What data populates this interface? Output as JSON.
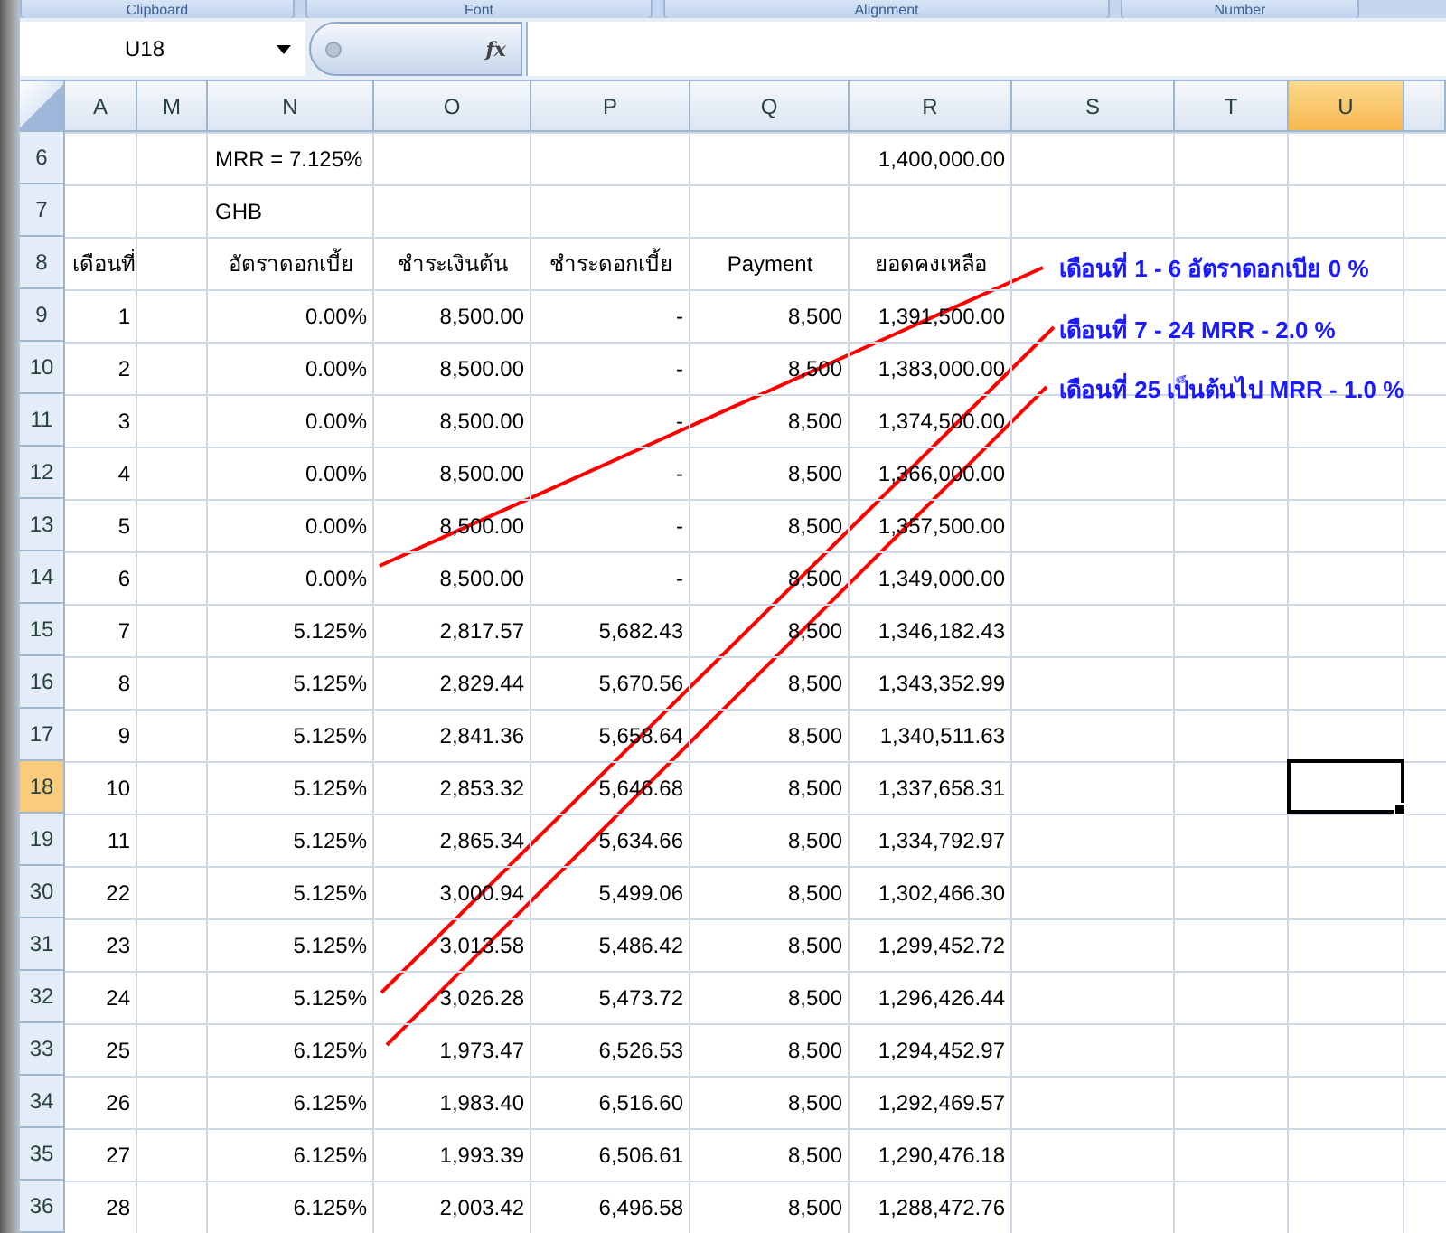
{
  "ribbon_groups": [
    {
      "label": "Clipboard"
    },
    {
      "label": "Font"
    },
    {
      "label": "Alignment"
    },
    {
      "label": "Number"
    }
  ],
  "formula_bar": {
    "name_box": "U18",
    "fx": "fx"
  },
  "columns": [
    {
      "label": "A",
      "selected": false
    },
    {
      "label": "M",
      "selected": false
    },
    {
      "label": "N",
      "selected": false
    },
    {
      "label": "O",
      "selected": false
    },
    {
      "label": "P",
      "selected": false
    },
    {
      "label": "Q",
      "selected": false
    },
    {
      "label": "R",
      "selected": false
    },
    {
      "label": "S",
      "selected": false
    },
    {
      "label": "T",
      "selected": false
    },
    {
      "label": "U",
      "selected": true
    }
  ],
  "rows": [
    {
      "num": "6",
      "selected": false,
      "kind": "note",
      "cells": {
        "N": "MRR = 7.125%",
        "R": "1,400,000.00"
      }
    },
    {
      "num": "7",
      "selected": false,
      "kind": "note",
      "cells": {
        "N": "GHB"
      }
    },
    {
      "num": "8",
      "selected": false,
      "kind": "header",
      "cells": {
        "A": "เดือนที่",
        "N": "อัตราดอกเบี้ย",
        "O": "ชำระเงินต้น",
        "P": "ชำระดอกเบี้ย",
        "Q": "Payment",
        "R": "ยอดคงเหลือ"
      }
    },
    {
      "num": "9",
      "selected": false,
      "kind": "data",
      "cells": {
        "A": "1",
        "N": "0.00%",
        "O": "8,500.00",
        "P": "-",
        "Q": "8,500",
        "R": "1,391,500.00"
      }
    },
    {
      "num": "10",
      "selected": false,
      "kind": "data",
      "cells": {
        "A": "2",
        "N": "0.00%",
        "O": "8,500.00",
        "P": "-",
        "Q": "8,500",
        "R": "1,383,000.00"
      }
    },
    {
      "num": "11",
      "selected": false,
      "kind": "data",
      "cells": {
        "A": "3",
        "N": "0.00%",
        "O": "8,500.00",
        "P": "-",
        "Q": "8,500",
        "R": "1,374,500.00"
      }
    },
    {
      "num": "12",
      "selected": false,
      "kind": "data",
      "cells": {
        "A": "4",
        "N": "0.00%",
        "O": "8,500.00",
        "P": "-",
        "Q": "8,500",
        "R": "1,366,000.00"
      }
    },
    {
      "num": "13",
      "selected": false,
      "kind": "data",
      "cells": {
        "A": "5",
        "N": "0.00%",
        "O": "8,500.00",
        "P": "-",
        "Q": "8,500",
        "R": "1,357,500.00"
      }
    },
    {
      "num": "14",
      "selected": false,
      "kind": "data",
      "cells": {
        "A": "6",
        "N": "0.00%",
        "O": "8,500.00",
        "P": "-",
        "Q": "8,500",
        "R": "1,349,000.00"
      }
    },
    {
      "num": "15",
      "selected": false,
      "kind": "data",
      "cells": {
        "A": "7",
        "N": "5.125%",
        "O": "2,817.57",
        "P": "5,682.43",
        "Q": "8,500",
        "R": "1,346,182.43"
      }
    },
    {
      "num": "16",
      "selected": false,
      "kind": "data",
      "cells": {
        "A": "8",
        "N": "5.125%",
        "O": "2,829.44",
        "P": "5,670.56",
        "Q": "8,500",
        "R": "1,343,352.99"
      }
    },
    {
      "num": "17",
      "selected": false,
      "kind": "data",
      "cells": {
        "A": "9",
        "N": "5.125%",
        "O": "2,841.36",
        "P": "5,658.64",
        "Q": "8,500",
        "R": "1,340,511.63"
      }
    },
    {
      "num": "18",
      "selected": true,
      "kind": "data",
      "cells": {
        "A": "10",
        "N": "5.125%",
        "O": "2,853.32",
        "P": "5,646.68",
        "Q": "8,500",
        "R": "1,337,658.31"
      }
    },
    {
      "num": "19",
      "selected": false,
      "kind": "data",
      "cells": {
        "A": "11",
        "N": "5.125%",
        "O": "2,865.34",
        "P": "5,634.66",
        "Q": "8,500",
        "R": "1,334,792.97"
      }
    },
    {
      "num": "30",
      "selected": false,
      "kind": "data",
      "cells": {
        "A": "22",
        "N": "5.125%",
        "O": "3,000.94",
        "P": "5,499.06",
        "Q": "8,500",
        "R": "1,302,466.30"
      }
    },
    {
      "num": "31",
      "selected": false,
      "kind": "data",
      "cells": {
        "A": "23",
        "N": "5.125%",
        "O": "3,013.58",
        "P": "5,486.42",
        "Q": "8,500",
        "R": "1,299,452.72"
      }
    },
    {
      "num": "32",
      "selected": false,
      "kind": "data",
      "cells": {
        "A": "24",
        "N": "5.125%",
        "O": "3,026.28",
        "P": "5,473.72",
        "Q": "8,500",
        "R": "1,296,426.44"
      }
    },
    {
      "num": "33",
      "selected": false,
      "kind": "data",
      "cells": {
        "A": "25",
        "N": "6.125%",
        "O": "1,973.47",
        "P": "6,526.53",
        "Q": "8,500",
        "R": "1,294,452.97"
      }
    },
    {
      "num": "34",
      "selected": false,
      "kind": "data",
      "cells": {
        "A": "26",
        "N": "6.125%",
        "O": "1,983.40",
        "P": "6,516.60",
        "Q": "8,500",
        "R": "1,292,469.57"
      }
    },
    {
      "num": "35",
      "selected": false,
      "kind": "data",
      "cells": {
        "A": "27",
        "N": "6.125%",
        "O": "1,993.39",
        "P": "6,506.61",
        "Q": "8,500",
        "R": "1,290,476.18"
      }
    },
    {
      "num": "36",
      "selected": false,
      "kind": "data",
      "cells": {
        "A": "28",
        "N": "6.125%",
        "O": "2,003.42",
        "P": "6,496.58",
        "Q": "8,500",
        "R": "1,288,472.76"
      }
    }
  ],
  "annotations": [
    {
      "text": "เดือนที่ 1 - 6 อัตราดอกเบีย 0 %"
    },
    {
      "text": "เดือนที่ 7 - 24 MRR - 2.0 %"
    },
    {
      "text": "เดือนที่ 25 เป็นต้นไป MRR - 1.0 %"
    }
  ]
}
